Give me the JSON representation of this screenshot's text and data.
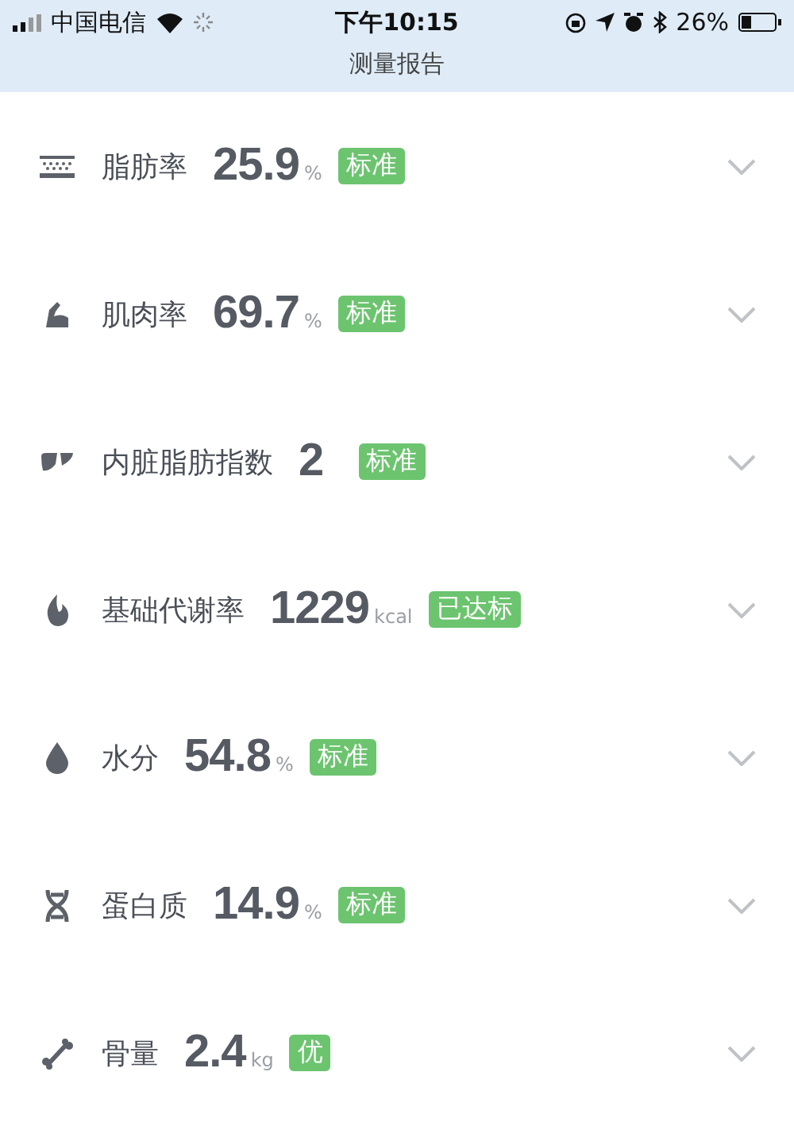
{
  "status_bar": {
    "carrier": "中国电信",
    "time": "下午10:15",
    "battery": "26%"
  },
  "title": "测量报告",
  "metrics": [
    {
      "name": "脂肪率",
      "value": "25.9",
      "unit": "%",
      "badge": "标准",
      "expanded": false
    },
    {
      "name": "肌肉率",
      "value": "69.7",
      "unit": "%",
      "badge": "标准",
      "expanded": false
    },
    {
      "name": "内脏脂肪指数",
      "value": "2",
      "badge": "标准",
      "expanded": false
    },
    {
      "name": "基础代谢率",
      "value": "1229",
      "unit": "kcal",
      "badge": "已达标",
      "expanded": false
    },
    {
      "name": "水分",
      "value": "54.8",
      "unit": "%",
      "badge": "标准",
      "expanded": false
    },
    {
      "name": "蛋白质",
      "value": "14.9",
      "unit": "%",
      "badge": "标准",
      "expanded": false
    },
    {
      "name": "骨量",
      "value": "2.4",
      "unit": "kg",
      "badge": "优",
      "expanded": false
    }
  ]
}
